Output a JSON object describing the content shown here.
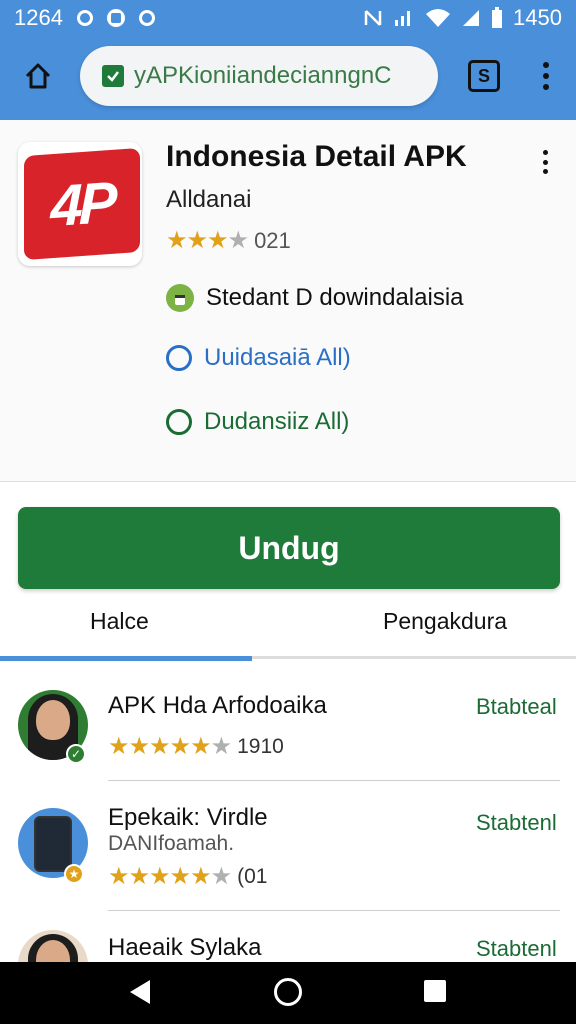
{
  "status_bar": {
    "time_left": "1264",
    "time_right": "1450"
  },
  "browser": {
    "url": "yAPKioniiandecianngnC",
    "tabs_count": "S"
  },
  "app": {
    "title": "Indonesia Detail APK",
    "icon_text": "4P",
    "developer": "Alldanai",
    "rating_count": "021",
    "info1": "Stedant D dowindalaisia",
    "info2": "Uuidasaiā All)",
    "info3": "Dudansiiz All)"
  },
  "download": {
    "label": "Undug"
  },
  "tabs": {
    "left": "Halce",
    "right": "Pengakdura"
  },
  "list": [
    {
      "title": "APK Hda Arfodoaika",
      "subtitle": "",
      "rating": "1910",
      "action": "Btabteal"
    },
    {
      "title": "Epekaik: Virdle",
      "subtitle": "DANIfoamah.",
      "rating": "(01",
      "action": "Stabtenl"
    },
    {
      "title": "Haeaik Sylaka",
      "subtitle": "",
      "rating": "",
      "action": "Stabtenl"
    }
  ],
  "colors": {
    "primary": "#4a8fd9",
    "download": "#1e7b3a",
    "star": "#e0a21a",
    "icon_red": "#d8232a"
  }
}
